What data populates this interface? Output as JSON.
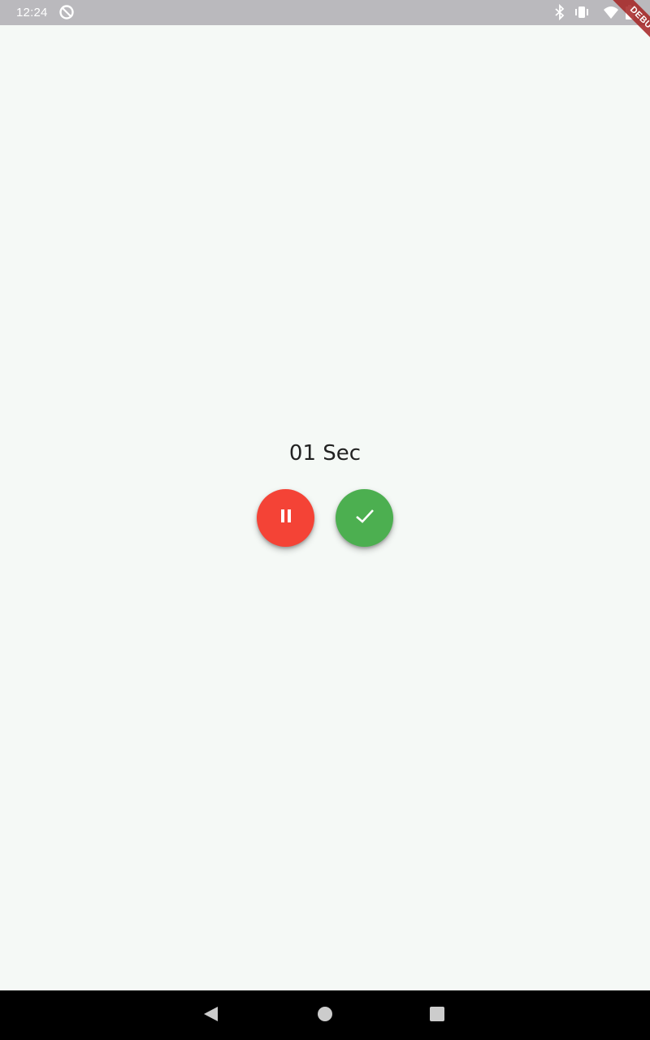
{
  "status_bar": {
    "time": "12:24",
    "icons": [
      "sync-disabled-icon",
      "bluetooth-icon",
      "vibrate-icon",
      "wifi-icon",
      "battery-icon"
    ]
  },
  "debug_banner": {
    "label": "DEBUG"
  },
  "timer": {
    "text": "01 Sec"
  },
  "actions": {
    "pause": {
      "icon": "pause-icon",
      "color": "#f44336"
    },
    "done": {
      "icon": "check-icon",
      "color": "#4caf50"
    }
  },
  "nav_bar": {
    "buttons": [
      "back-icon",
      "home-icon",
      "recents-icon"
    ]
  },
  "colors": {
    "background": "#f5f9f6",
    "status_bar": "#bab9bd",
    "nav_bar": "#000000"
  }
}
